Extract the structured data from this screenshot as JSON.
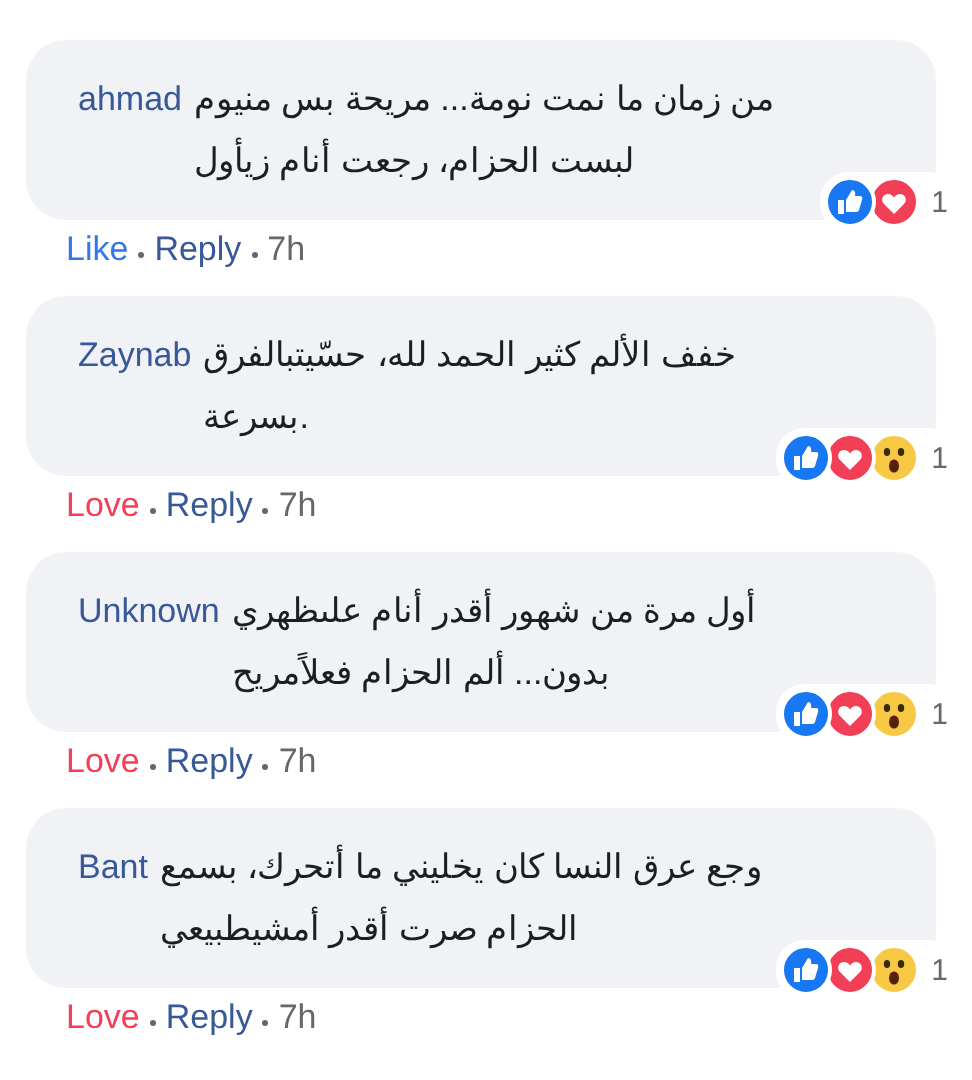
{
  "comments": [
    {
      "author": "ahmad",
      "text": "من زمان ما نمت نومة... مريحة بس منيوم لبست الحزام، رجعت أنام زيأول",
      "reactions": [
        {
          "kind": "like"
        },
        {
          "kind": "love"
        }
      ],
      "reaction_count": "1",
      "my_reaction": {
        "label": "Like",
        "kind": "like"
      },
      "reply": "Reply",
      "time": "7h"
    },
    {
      "author": "Zaynab",
      "text": "خفف الألم كثير الحمد لله، حسّيتبالفرق بسرعة.",
      "reactions": [
        {
          "kind": "like"
        },
        {
          "kind": "love"
        },
        {
          "kind": "wow"
        }
      ],
      "reaction_count": "1",
      "my_reaction": {
        "label": "Love",
        "kind": "love"
      },
      "reply": "Reply",
      "time": "7h"
    },
    {
      "author": "Unknown",
      "text": "أول مرة من شهور أقدر أنام علىظهري بدون... ألم الحزام فعلاًمريح",
      "reactions": [
        {
          "kind": "like"
        },
        {
          "kind": "love"
        },
        {
          "kind": "wow"
        }
      ],
      "reaction_count": "1",
      "my_reaction": {
        "label": "Love",
        "kind": "love"
      },
      "reply": "Reply",
      "time": "7h"
    },
    {
      "author": "Bant",
      "text": "وجع عرق النسا كان يخليني ما أتحرك، بسمع الحزام صرت أقدر أمشيطبيعي",
      "reactions": [
        {
          "kind": "like"
        },
        {
          "kind": "love"
        },
        {
          "kind": "wow"
        }
      ],
      "reaction_count": "1",
      "my_reaction": {
        "label": "Love",
        "kind": "love"
      },
      "reply": "Reply",
      "time": "7h"
    }
  ]
}
